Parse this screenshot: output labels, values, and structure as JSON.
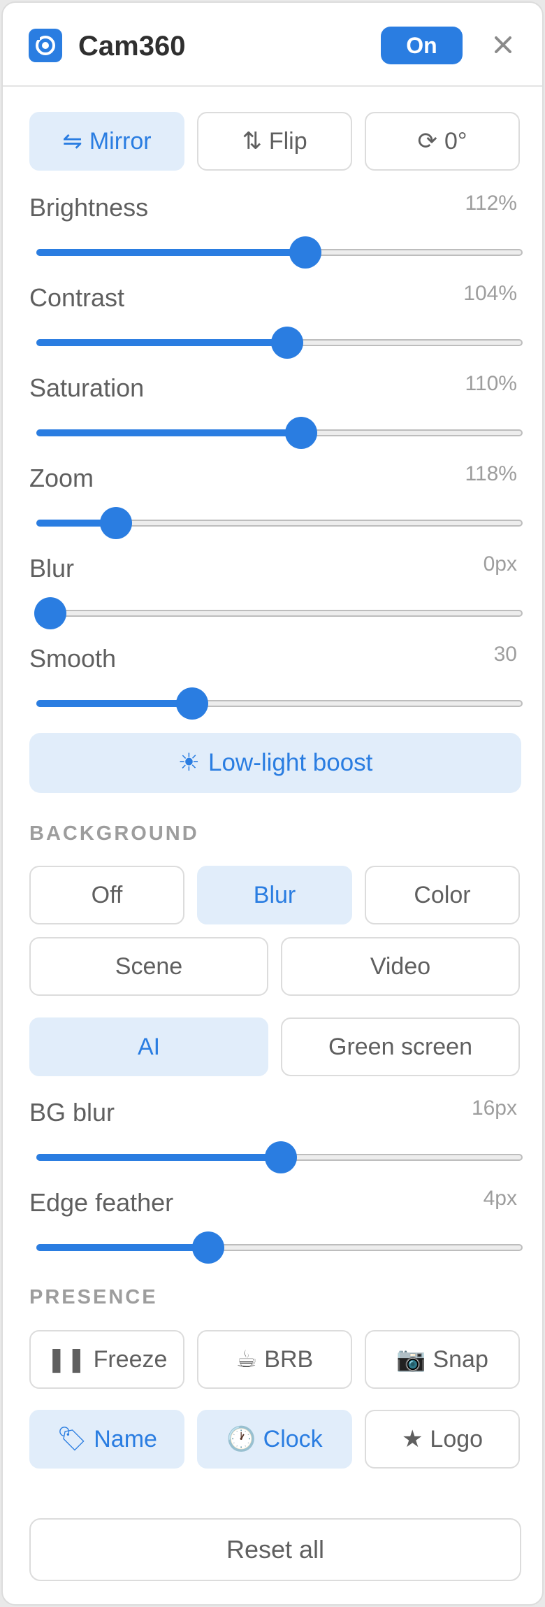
{
  "app": {
    "title": "Cam360",
    "status": "On",
    "accent": "#2a7de1"
  },
  "transform": [
    {
      "icon": "⇋",
      "label": "Mirror",
      "active": true
    },
    {
      "icon": "⇅",
      "label": "Flip",
      "active": false
    },
    {
      "icon": "⟳",
      "label": "0°",
      "active": false
    }
  ],
  "sliders": [
    {
      "label": "Brightness",
      "value": "112%",
      "fraction": 0.553
    },
    {
      "label": "Contrast",
      "value": "104%",
      "fraction": 0.514
    },
    {
      "label": "Saturation",
      "value": "110%",
      "fraction": 0.544
    },
    {
      "label": "Zoom",
      "value": "118%",
      "fraction": 0.143
    },
    {
      "label": "Blur",
      "value": "0px",
      "fraction": 0.0
    },
    {
      "label": "Smooth",
      "value": "30",
      "fraction": 0.308
    }
  ],
  "lowlight": {
    "icon": "☀",
    "label": "Low-light boost"
  },
  "background": {
    "title": "BACKGROUND",
    "modes": [
      {
        "label": "Off",
        "active": false
      },
      {
        "label": "Blur",
        "active": true
      },
      {
        "label": "Color",
        "active": false
      },
      {
        "label": "Scene",
        "active": false
      },
      {
        "label": "Video",
        "active": false
      }
    ],
    "segmentation": [
      {
        "label": "AI",
        "active": true
      },
      {
        "label": "Green screen",
        "active": false
      }
    ],
    "sliders": [
      {
        "label": "BG blur",
        "value": "16px",
        "fraction": 0.5
      },
      {
        "label": "Edge feather",
        "value": "4px",
        "fraction": 0.342
      }
    ]
  },
  "presence": {
    "title": "PRESENCE",
    "buttons": [
      {
        "icon": "❚❚",
        "label": "Freeze",
        "active": false
      },
      {
        "icon": "☕",
        "label": "BRB",
        "active": false
      },
      {
        "icon": "📷",
        "label": "Snap",
        "active": false
      },
      {
        "icon": "🏷",
        "label": "Name",
        "active": true
      },
      {
        "icon": "🕐",
        "label": "Clock",
        "active": true
      },
      {
        "icon": "★",
        "label": "Logo",
        "active": false
      }
    ]
  },
  "reset": {
    "label": "Reset all"
  }
}
